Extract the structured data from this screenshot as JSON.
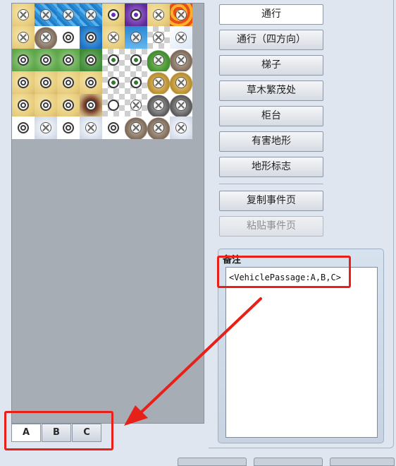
{
  "buttons": [
    {
      "id": "passage",
      "label": "通行",
      "state": "highlighted"
    },
    {
      "id": "passage-4dir",
      "label": "通行（四方向）",
      "state": "normal"
    },
    {
      "id": "ladder",
      "label": "梯子",
      "state": "normal"
    },
    {
      "id": "bush",
      "label": "草木繁茂处",
      "state": "normal"
    },
    {
      "id": "counter",
      "label": "柜台",
      "state": "normal"
    },
    {
      "id": "damage-floor",
      "label": "有害地形",
      "state": "normal"
    },
    {
      "id": "terrain-tag",
      "label": "地形标志",
      "state": "normal"
    },
    {
      "id": "copy-page",
      "label": "复制事件页",
      "state": "normal"
    },
    {
      "id": "paste-page",
      "label": "粘贴事件页",
      "state": "disabled"
    }
  ],
  "note": {
    "title": "备注",
    "value": "<VehiclePassage:A,B,C>"
  },
  "tabs": [
    {
      "label": "A",
      "active": true
    },
    {
      "label": "B",
      "active": false
    },
    {
      "label": "C",
      "active": false
    }
  ],
  "colors": {
    "annotation": "#e8201a",
    "panel_bg": "#a7adb5",
    "window_bg": "#dfe6ef"
  },
  "tileset": {
    "rows": [
      [
        {
          "bg": "sand",
          "mk": "cross"
        },
        {
          "bg": "water",
          "mk": "cross"
        },
        {
          "bg": "water",
          "mk": "cross"
        },
        {
          "bg": "water",
          "mk": "cross"
        },
        {
          "bg": "sand",
          "mk": "pdot"
        },
        {
          "bg": "purple",
          "mk": "pdot"
        },
        {
          "bg": "sand",
          "mk": "cross"
        },
        {
          "bg": "lava",
          "mk": "cross"
        }
      ],
      [
        {
          "bg": "sand",
          "mk": "cross"
        },
        {
          "bg": "rock",
          "mk": "cross"
        },
        {
          "bg": "snow",
          "mk": "circle"
        },
        {
          "bg": "deep",
          "mk": "circle"
        },
        {
          "bg": "sand",
          "mk": "cross"
        },
        {
          "bg": "tree",
          "mk": "cross"
        },
        {
          "bg": "check",
          "mk": "cross"
        },
        {
          "bg": "snowg",
          "mk": "cross"
        }
      ],
      [
        {
          "bg": "grass",
          "mk": "circle"
        },
        {
          "bg": "grass",
          "mk": "circle"
        },
        {
          "bg": "grass",
          "mk": "circle"
        },
        {
          "bg": "dgrass",
          "mk": "circle"
        },
        {
          "bg": "check",
          "mk": "dot"
        },
        {
          "bg": "check",
          "mk": "dot"
        },
        {
          "bg": "hill",
          "mk": "cross"
        },
        {
          "bg": "rock",
          "mk": "cross"
        }
      ],
      [
        {
          "bg": "sand",
          "mk": "circle"
        },
        {
          "bg": "sand",
          "mk": "circle"
        },
        {
          "bg": "sand",
          "mk": "circle"
        },
        {
          "bg": "sand",
          "mk": "circle"
        },
        {
          "bg": "check",
          "mk": "dot"
        },
        {
          "bg": "check",
          "mk": "dot"
        },
        {
          "bg": "gold",
          "mk": "cross"
        },
        {
          "bg": "gold",
          "mk": "cross"
        }
      ],
      [
        {
          "bg": "sand",
          "mk": "circle"
        },
        {
          "bg": "sand",
          "mk": "circle"
        },
        {
          "bg": "sand",
          "mk": "circle"
        },
        {
          "bg": "crater",
          "mk": "circle"
        },
        {
          "bg": "check",
          "mk": "star"
        },
        {
          "bg": "check",
          "mk": "cross"
        },
        {
          "bg": "grock",
          "mk": "cross"
        },
        {
          "bg": "grock",
          "mk": "cross"
        }
      ],
      [
        {
          "bg": "snow",
          "mk": "circle"
        },
        {
          "bg": "cloud",
          "mk": "cross"
        },
        {
          "bg": "snow",
          "mk": "circle"
        },
        {
          "bg": "cloud",
          "mk": "cross"
        },
        {
          "bg": "snow",
          "mk": "circle"
        },
        {
          "bg": "rock",
          "mk": "cross"
        },
        {
          "bg": "rock",
          "mk": "cross"
        },
        {
          "bg": "cloud",
          "mk": "cross"
        }
      ]
    ]
  }
}
